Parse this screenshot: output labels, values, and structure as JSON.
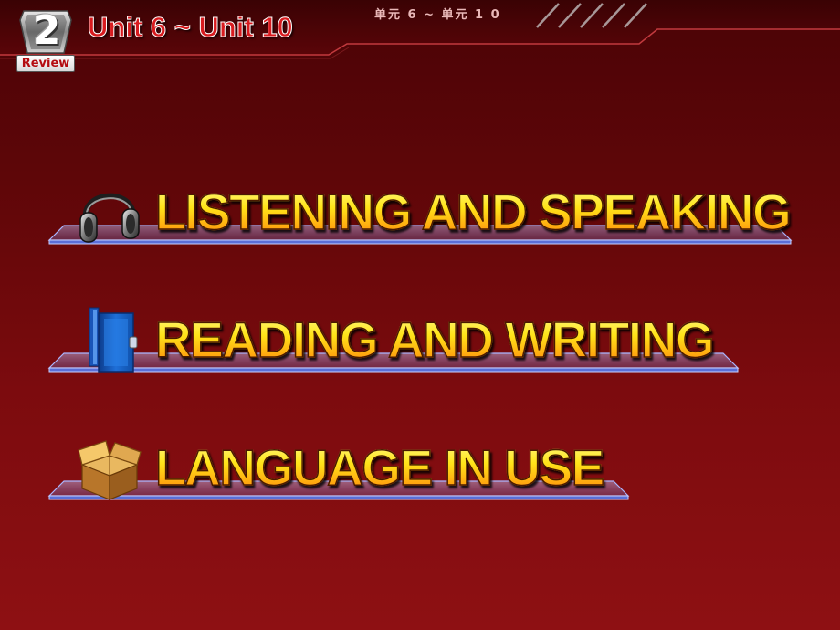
{
  "header": {
    "badge_number": "2",
    "badge_label": "Review",
    "title": "Unit 6 ~ Unit 10",
    "subtitle_cn": "单元 6 ~ 单元 1 0"
  },
  "menu": {
    "items": [
      {
        "label": "LISTENING AND SPEAKING",
        "icon": "headphones-icon"
      },
      {
        "label": "READING AND WRITING",
        "icon": "book-icon"
      },
      {
        "label": "LANGUAGE IN USE",
        "icon": "box-icon"
      }
    ]
  },
  "colors": {
    "background_top": "#4a0306",
    "background_bottom": "#8e1013",
    "title_red": "#d81b1f",
    "label_yellow": "#ffe417",
    "label_orange": "#ff7d08",
    "shelf_blue": "#5a6fd8"
  }
}
